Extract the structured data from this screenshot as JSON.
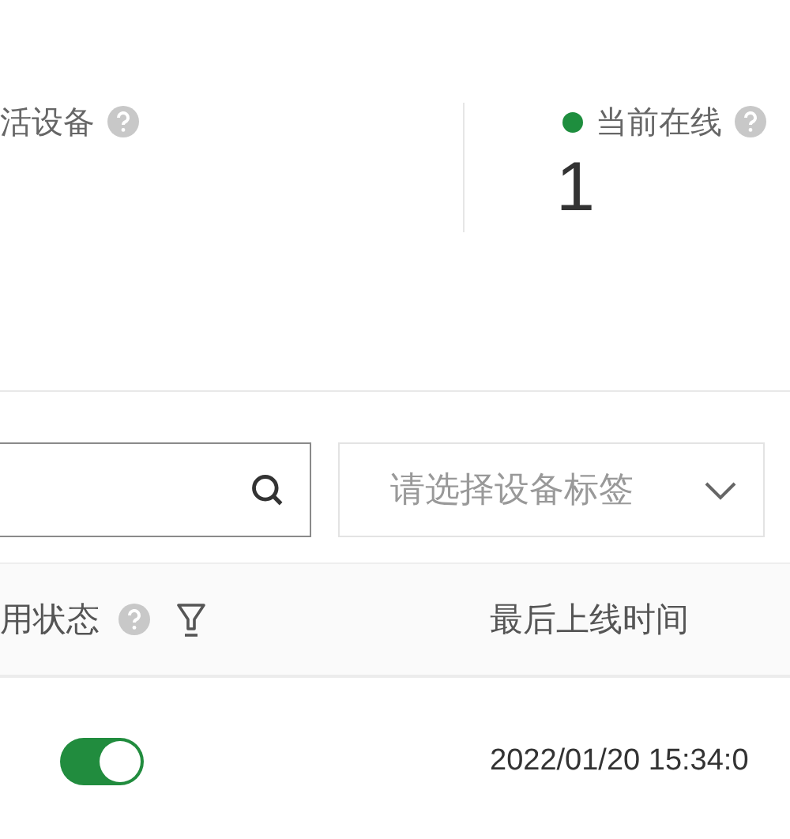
{
  "stats": [
    {
      "label": "活设备"
    },
    {
      "label": "当前在线",
      "color": "#1e8e3e",
      "value": "1"
    }
  ],
  "tag_select": {
    "placeholder": "请选择设备标签"
  },
  "table": {
    "columns": [
      {
        "label": "用状态",
        "kind": "filterable"
      },
      {
        "label": "最后上线时间",
        "kind": "plain"
      }
    ],
    "rows": [
      {
        "enabled": true,
        "last_online": "2022/01/20 15:34:0"
      }
    ]
  }
}
